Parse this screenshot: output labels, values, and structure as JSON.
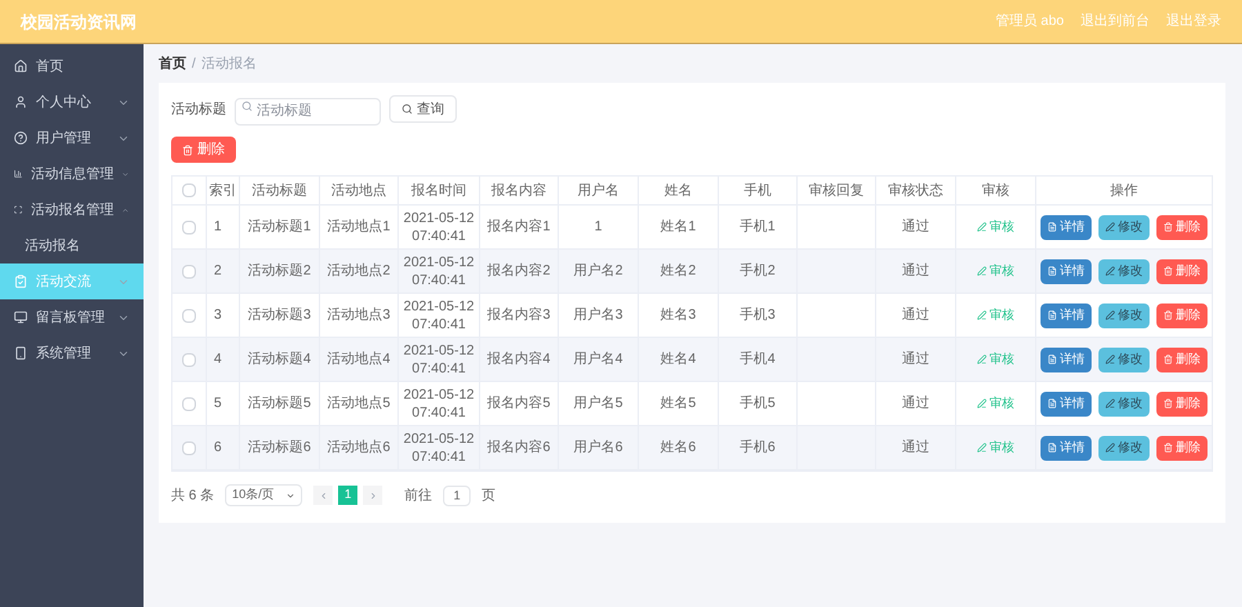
{
  "header": {
    "title": "校园活动资讯网",
    "links": [
      "管理员 abo",
      "退出到前台",
      "退出登录"
    ]
  },
  "sidebar": {
    "items": [
      {
        "label": "首页",
        "selected": false
      },
      {
        "label": "个人中心",
        "selected": false,
        "expanded": false
      },
      {
        "label": "用户管理",
        "selected": false,
        "expanded": false
      },
      {
        "label": "活动信息管理",
        "selected": false,
        "expanded": false
      },
      {
        "label": "活动报名管理",
        "selected": false,
        "expanded": true,
        "children": [
          {
            "label": "活动报名",
            "selected": false
          }
        ]
      },
      {
        "label": "活动交流",
        "selected": true,
        "expanded": false
      },
      {
        "label": "留言板管理",
        "selected": false,
        "expanded": false
      },
      {
        "label": "系统管理",
        "selected": false,
        "expanded": false
      }
    ]
  },
  "breadcrumb": [
    "首页",
    "/",
    "活动报名"
  ],
  "search": {
    "label": "活动标题",
    "placeholder": "活动标题",
    "button": "查询"
  },
  "delete_button": "删除",
  "table": {
    "header_checked": false,
    "columns": [
      "索引",
      "活动标题",
      "活动地点",
      "报名时间",
      "报名内容",
      "用户名",
      "姓名",
      "手机",
      "审核回复",
      "审核状态",
      "审核",
      "操作"
    ],
    "rows": [
      {
        "checked": false,
        "cells": [
          "1",
          "活动标题1",
          "活动地点1",
          "2021-05-12 07:40:41",
          "报名内容1",
          "1",
          "姓名1",
          "手机1",
          "",
          "通过"
        ],
        "review": "审核",
        "actions": [
          {
            "kind": "detail",
            "label": "详情"
          },
          {
            "kind": "edit",
            "label": "修改"
          },
          {
            "kind": "delete",
            "label": "删除"
          }
        ]
      },
      {
        "checked": false,
        "cells": [
          "2",
          "活动标题2",
          "活动地点2",
          "2021-05-12 07:40:41",
          "报名内容2",
          "用户名2",
          "姓名2",
          "手机2",
          "",
          "通过"
        ],
        "review": "审核",
        "actions": [
          {
            "kind": "detail",
            "label": "详情"
          },
          {
            "kind": "edit",
            "label": "修改"
          },
          {
            "kind": "delete",
            "label": "删除"
          }
        ]
      },
      {
        "checked": false,
        "cells": [
          "3",
          "活动标题3",
          "活动地点3",
          "2021-05-12 07:40:41",
          "报名内容3",
          "用户名3",
          "姓名3",
          "手机3",
          "",
          "通过"
        ],
        "review": "审核",
        "actions": [
          {
            "kind": "detail",
            "label": "详情"
          },
          {
            "kind": "edit",
            "label": "修改"
          },
          {
            "kind": "delete",
            "label": "删除"
          }
        ]
      },
      {
        "checked": false,
        "cells": [
          "4",
          "活动标题4",
          "活动地点4",
          "2021-05-12 07:40:41",
          "报名内容4",
          "用户名4",
          "姓名4",
          "手机4",
          "",
          "通过"
        ],
        "review": "审核",
        "actions": [
          {
            "kind": "detail",
            "label": "详情"
          },
          {
            "kind": "edit",
            "label": "修改"
          },
          {
            "kind": "delete",
            "label": "删除"
          }
        ]
      },
      {
        "checked": false,
        "cells": [
          "5",
          "活动标题5",
          "活动地点5",
          "2021-05-12 07:40:41",
          "报名内容5",
          "用户名5",
          "姓名5",
          "手机5",
          "",
          "通过"
        ],
        "review": "审核",
        "actions": [
          {
            "kind": "detail",
            "label": "详情"
          },
          {
            "kind": "edit",
            "label": "修改"
          },
          {
            "kind": "delete",
            "label": "删除"
          }
        ]
      },
      {
        "checked": false,
        "cells": [
          "6",
          "活动标题6",
          "活动地点6",
          "2021-05-12 07:40:41",
          "报名内容6",
          "用户名6",
          "姓名6",
          "手机6",
          "",
          "通过"
        ],
        "review": "审核",
        "actions": [
          {
            "kind": "detail",
            "label": "详情"
          },
          {
            "kind": "edit",
            "label": "修改"
          },
          {
            "kind": "delete",
            "label": "删除"
          }
        ]
      }
    ]
  },
  "pagination": {
    "total": "共 6 条",
    "page_size": "10条/页",
    "pages": [
      {
        "label": "1",
        "selected": true
      }
    ],
    "goto_label": "前往",
    "goto_value": "1",
    "goto_suffix": "页"
  }
}
